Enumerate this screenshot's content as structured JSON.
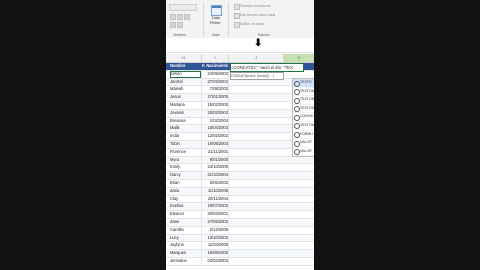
{
  "ribbon": {
    "number_format": "Número",
    "date_label": "Date",
    "picker_label": "Picker",
    "groups": {
      "number": "Número",
      "date": "Date",
      "editing": "Edición"
    },
    "items": [
      "Formato condicional",
      "Dar formato como tabla",
      "Estilos de celda"
    ]
  },
  "columns": {
    "h": "H",
    "i": "I",
    "j": "J",
    "k": "K"
  },
  "table": {
    "headers": {
      "name": "Nombre",
      "date": "F. Nacimiento"
    },
    "rows": [
      {
        "name": "Simon",
        "date": "24/09/2003"
      },
      {
        "name": "Jaritzel",
        "date": "27/02/2004"
      },
      {
        "name": "Maleah",
        "date": "7/08/2002"
      },
      {
        "name": "Jesus",
        "date": "27/01/2005"
      },
      {
        "name": "Mariana",
        "date": "15/02/2000"
      },
      {
        "name": "Jovanni",
        "date": "25/03/2003"
      },
      {
        "name": "Breanna",
        "date": "1/02/2004"
      },
      {
        "name": "Malik",
        "date": "15/04/2003"
      },
      {
        "name": "India",
        "date": "12/02/2002"
      },
      {
        "name": "Tobin",
        "date": "16/09/2003"
      },
      {
        "name": "Florence",
        "date": "21/11/2001"
      },
      {
        "name": "Myra",
        "date": "8/01/2000"
      },
      {
        "name": "Emily",
        "date": "23/10/2000"
      },
      {
        "name": "Darcy",
        "date": "31/10/2004"
      },
      {
        "name": "Brian",
        "date": "6/05/2002"
      },
      {
        "name": "Zaria",
        "date": "11/10/2005"
      },
      {
        "name": "Clay",
        "date": "20/11/2004"
      },
      {
        "name": "Evelina",
        "date": "19/07/2002"
      },
      {
        "name": "Eleanor",
        "date": "20/03/2001"
      },
      {
        "name": "Zane",
        "date": "27/05/2002"
      },
      {
        "name": "Camilla",
        "date": "2/12/2005"
      },
      {
        "name": "Lucy",
        "date": "13/10/2002"
      },
      {
        "name": "Jaylynn",
        "date": "11/04/2000"
      },
      {
        "name": "Marques",
        "date": "16/08/2000"
      },
      {
        "name": "Jermaine",
        "date": "02/02/2003"
      }
    ]
  },
  "formula": {
    "text": "=CONCAT(I2;\" nació el día \";TEX",
    "tooltip": "CONCAT(texto1; [texto2]; ...)"
  },
  "autocomplete": {
    "typed": "TEXTO",
    "items": [
      "TEXTO",
      "TEXTOAN",
      "TEXTOB",
      "TEXTOD",
      "CONVIE",
      "TEXTOA",
      "FORMU",
      "VALOR",
      "VALOR"
    ]
  }
}
